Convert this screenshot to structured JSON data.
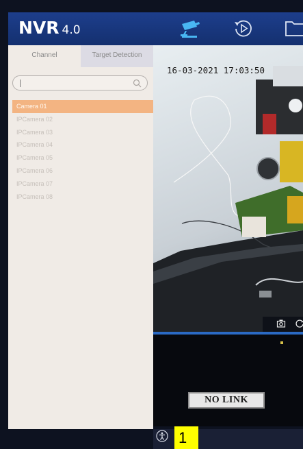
{
  "header": {
    "brand": "NVR",
    "version": "4.0",
    "icons": [
      "camera-live-icon",
      "playback-icon",
      "folder-icon"
    ]
  },
  "channel_panel": {
    "tabs": [
      {
        "label": "Channel",
        "active": true
      },
      {
        "label": "Target Detection",
        "active": false
      }
    ],
    "search": {
      "value": "",
      "placeholder": ""
    },
    "cameras": [
      {
        "label": "Camera 01",
        "selected": true
      },
      {
        "label": "IPCamera 02",
        "selected": false
      },
      {
        "label": "IPCamera 03",
        "selected": false
      },
      {
        "label": "IPCamera 04",
        "selected": false
      },
      {
        "label": "IPCamera 05",
        "selected": false
      },
      {
        "label": "IPCamera 06",
        "selected": false
      },
      {
        "label": "IPCamera 07",
        "selected": false
      },
      {
        "label": "IPCamera 08",
        "selected": false
      }
    ]
  },
  "live_view": {
    "timestamp": "16-03-2021 17:03:50",
    "toolbar_icons": [
      "snapshot-icon",
      "record-icon"
    ]
  },
  "tile2": {
    "status": "NO LINK"
  },
  "footer": {
    "icon": "accessibility-icon",
    "badge": "1"
  },
  "colors": {
    "header": "#1d3e8c",
    "selection": "#f3b482",
    "accent": "#2b6ac4",
    "badge": "#ffff00"
  }
}
